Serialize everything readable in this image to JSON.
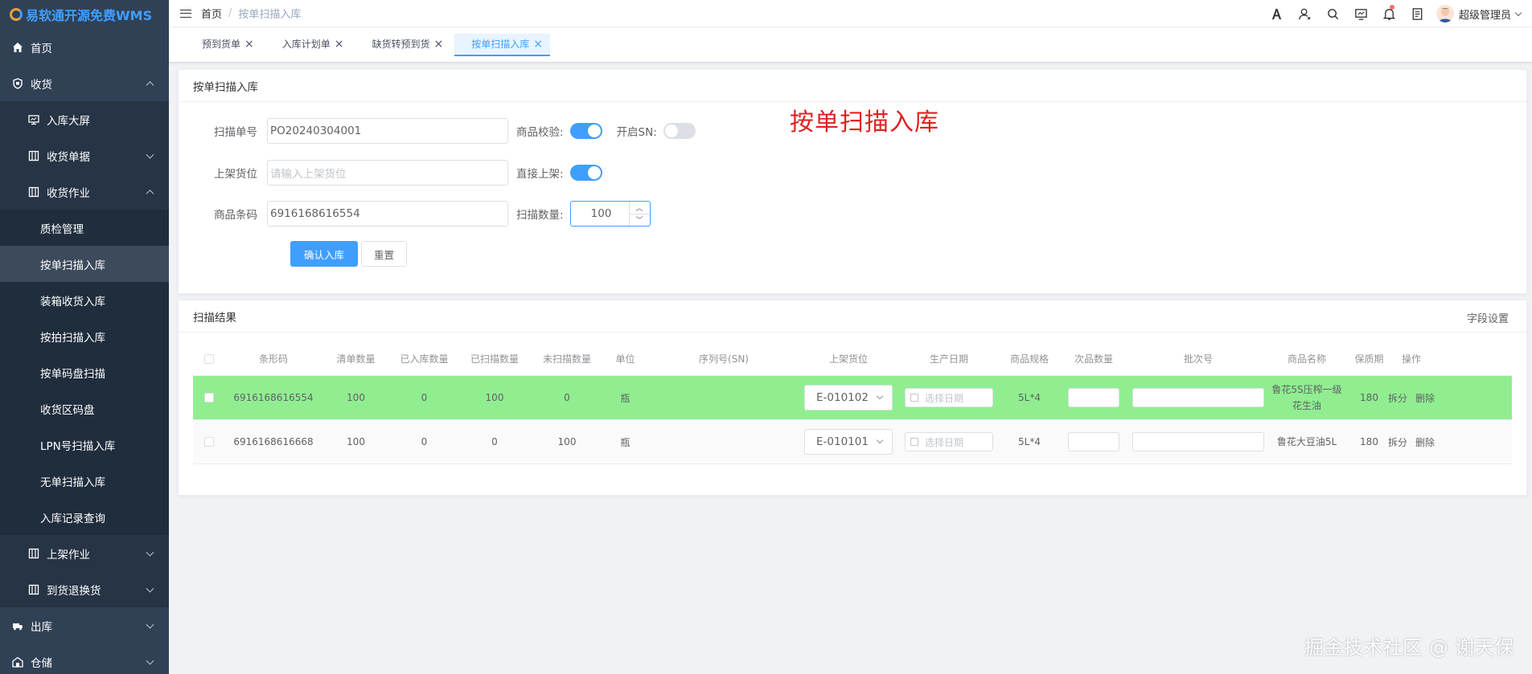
{
  "app": {
    "logo_text": "易软通开源免费WMS"
  },
  "sidebar": {
    "items": [
      {
        "label": "首页",
        "level": 1,
        "icon": "home-icon"
      },
      {
        "label": "收货",
        "level": 1,
        "icon": "shield-icon",
        "expanded": true
      },
      {
        "label": "入库大屏",
        "level": 2,
        "icon": "monitor-icon"
      },
      {
        "label": "收货单据",
        "level": 2,
        "icon": "grid-icon",
        "collapsed": true
      },
      {
        "label": "收货作业",
        "level": 2,
        "icon": "grid-icon",
        "expanded": true
      },
      {
        "label": "质检管理",
        "level": 3
      },
      {
        "label": "按单扫描入库",
        "level": 3,
        "active": true
      },
      {
        "label": "装箱收货入库",
        "level": 3
      },
      {
        "label": "按拍扫描入库",
        "level": 3
      },
      {
        "label": "按单码盘扫描",
        "level": 3
      },
      {
        "label": "收货区码盘",
        "level": 3
      },
      {
        "label": "LPN号扫描入库",
        "level": 3
      },
      {
        "label": "无单扫描入库",
        "level": 3
      },
      {
        "label": "入库记录查询",
        "level": 3
      },
      {
        "label": "上架作业",
        "level": 2,
        "icon": "grid-icon",
        "collapsed": true
      },
      {
        "label": "到货退换货",
        "level": 2,
        "icon": "grid-icon",
        "collapsed": true
      },
      {
        "label": "出库",
        "level": 1,
        "icon": "truck-icon",
        "collapsed": true
      },
      {
        "label": "仓储",
        "level": 1,
        "icon": "warehouse-icon",
        "collapsed": true
      }
    ]
  },
  "header": {
    "breadcrumb_home": "首页",
    "breadcrumb_sep": "/",
    "breadcrumb_current": "按单扫描入库",
    "username": "超级管理员"
  },
  "tags": [
    {
      "label": "预到货单",
      "active": false
    },
    {
      "label": "入库计划单",
      "active": false
    },
    {
      "label": "缺货转预到货",
      "active": false
    },
    {
      "label": "按单扫描入库",
      "active": true
    }
  ],
  "scan_form": {
    "title": "按单扫描入库",
    "order_label": "扫描单号",
    "order_value": "PO20240304001",
    "location_label": "上架货位",
    "location_placeholder": "请输入上架货位",
    "barcode_label": "商品条码",
    "barcode_value": "6916168616554",
    "check_label": "商品校验:",
    "check_on": true,
    "sn_label": "开启SN:",
    "sn_on": false,
    "direct_label": "直接上架:",
    "direct_on": true,
    "qty_label": "扫描数量:",
    "qty_value": "100",
    "confirm_label": "确认入库",
    "reset_label": "重置",
    "banner": "按单扫描入库"
  },
  "results": {
    "title": "扫描结果",
    "field_settings": "字段设置",
    "columns": [
      "条形码",
      "清单数量",
      "已入库数量",
      "已扫描数量",
      "未扫描数量",
      "单位",
      "序列号(SN)",
      "上架货位",
      "生产日期",
      "商品规格",
      "次品数量",
      "批次号",
      "商品名称",
      "保质期",
      "操作"
    ],
    "date_placeholder": "选择日期",
    "op_split": "拆分",
    "op_delete": "删除",
    "rows": [
      {
        "barcode": "6916168616554",
        "list_qty": "100",
        "in_qty": "0",
        "scanned": "100",
        "unscanned": "0",
        "unit": "瓶",
        "sn": "",
        "location": "E-010102",
        "spec": "5L*4",
        "name": "鲁花5S压榨一级花生油",
        "shelf": "180",
        "highlight": true
      },
      {
        "barcode": "6916168616668",
        "list_qty": "100",
        "in_qty": "0",
        "scanned": "0",
        "unscanned": "100",
        "unit": "瓶",
        "sn": "",
        "location": "E-010101",
        "spec": "5L*4",
        "name": "鲁花大豆油5L",
        "shelf": "180",
        "highlight": false
      }
    ]
  },
  "watermark": "掘金技术社区 @ 谢天保",
  "colors": {
    "sidebar": "#304156",
    "primary": "#409eff",
    "row_highlight": "#90ee90",
    "banner_red": "#e02020"
  }
}
